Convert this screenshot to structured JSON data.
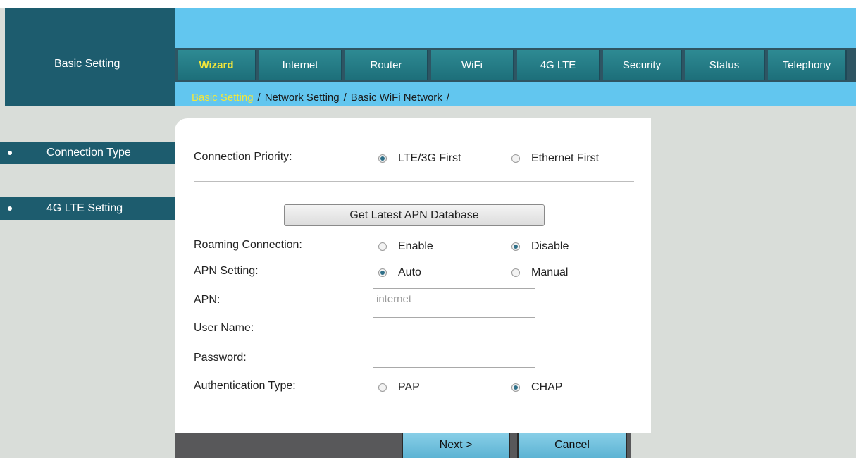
{
  "header": {
    "brand_label": "Basic Setting",
    "tabs": [
      {
        "label": "Wizard",
        "active": true
      },
      {
        "label": "Internet"
      },
      {
        "label": "Router"
      },
      {
        "label": "WiFi"
      },
      {
        "label": "4G LTE"
      },
      {
        "label": "Security"
      },
      {
        "label": "Status"
      },
      {
        "label": "Telephony"
      }
    ],
    "breadcrumbs": [
      "Basic Setting",
      "Network Setting",
      "Basic WiFi Network"
    ],
    "breadcrumb_separator": "/"
  },
  "sidebar": {
    "items": [
      {
        "label": "Connection Type",
        "active": true
      },
      {
        "label": "4G LTE Setting"
      }
    ]
  },
  "form": {
    "connection_priority": {
      "label": "Connection Priority:",
      "options": [
        "LTE/3G First",
        "Ethernet First"
      ],
      "selected": "LTE/3G First"
    },
    "apn_db_button": "Get Latest APN Database",
    "roaming": {
      "label": "Roaming Connection:",
      "options": [
        "Enable",
        "Disable"
      ],
      "selected": "Disable"
    },
    "apn_setting": {
      "label": "APN Setting:",
      "options": [
        "Auto",
        "Manual"
      ],
      "selected": "Auto"
    },
    "apn": {
      "label": "APN:",
      "value": "internet"
    },
    "username": {
      "label": "User Name:",
      "value": ""
    },
    "password": {
      "label": "Password:",
      "value": ""
    },
    "auth_type": {
      "label": "Authentication Type:",
      "options": [
        "PAP",
        "CHAP"
      ],
      "selected": "CHAP"
    }
  },
  "footer": {
    "next_label": "Next >",
    "cancel_label": "Cancel"
  },
  "colors": {
    "brand_teal": "#1d5c6e",
    "header_blue": "#62c6ef",
    "active_yellow": "#f4e73a"
  }
}
